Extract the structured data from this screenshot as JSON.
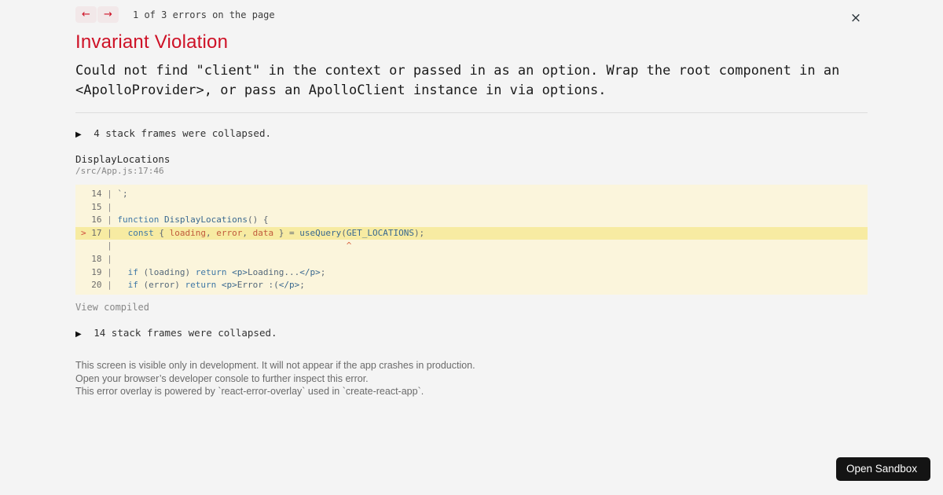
{
  "colors": {
    "accent_red": "#ce1126",
    "page_bg": "#f4f4f4",
    "code_bg": "#fbf5dc",
    "code_highlight_bg": "#f7eba2",
    "button_bg": "#141414"
  },
  "header": {
    "prev_label": "←",
    "next_label": "→",
    "counter": "1 of 3 errors on the page",
    "close_label": "×"
  },
  "error": {
    "title": "Invariant Violation",
    "message": "Could not find \"client\" in the context or passed in as an option. Wrap the root component in an <ApolloProvider>, or pass an ApolloClient instance in via options."
  },
  "stack": {
    "collapse_icon": "▶",
    "collapsed_top": "4 stack frames were collapsed.",
    "frame": {
      "function": "DisplayLocations",
      "location": "/src/App.js:17:46"
    },
    "view_compiled": "View compiled",
    "collapsed_bottom": "14 stack frames were collapsed."
  },
  "code": {
    "lines": [
      {
        "marker": "",
        "num": "14",
        "hl": false,
        "tokens": [
          {
            "t": "`;",
            "c": "pn"
          }
        ]
      },
      {
        "marker": "",
        "num": "15",
        "hl": false,
        "tokens": []
      },
      {
        "marker": "",
        "num": "16",
        "hl": false,
        "tokens": [
          {
            "t": "function",
            "c": "kw"
          },
          {
            "t": " ",
            "c": "pn"
          },
          {
            "t": "DisplayLocations",
            "c": "fn"
          },
          {
            "t": "() {",
            "c": "pn"
          }
        ]
      },
      {
        "marker": ">",
        "num": "17",
        "hl": true,
        "tokens": [
          {
            "t": "  ",
            "c": "pn"
          },
          {
            "t": "const",
            "c": "kw"
          },
          {
            "t": " { ",
            "c": "pn"
          },
          {
            "t": "loading",
            "c": "vr"
          },
          {
            "t": ", ",
            "c": "pn"
          },
          {
            "t": "error",
            "c": "vr"
          },
          {
            "t": ", ",
            "c": "pn"
          },
          {
            "t": "data",
            "c": "vr"
          },
          {
            "t": " } = ",
            "c": "pn"
          },
          {
            "t": "useQuery",
            "c": "fn"
          },
          {
            "t": "(",
            "c": "pn"
          },
          {
            "t": "GET_LOCATIONS",
            "c": "fn"
          },
          {
            "t": ");",
            "c": "pn"
          }
        ]
      },
      {
        "marker": "",
        "num": "",
        "hl": false,
        "tokens": [
          {
            "t": "                                            ^",
            "c": "caret"
          }
        ]
      },
      {
        "marker": "",
        "num": "18",
        "hl": false,
        "tokens": []
      },
      {
        "marker": "",
        "num": "19",
        "hl": false,
        "tokens": [
          {
            "t": "  ",
            "c": "pn"
          },
          {
            "t": "if",
            "c": "kw"
          },
          {
            "t": " (",
            "c": "pn"
          },
          {
            "t": "loading",
            "c": "id"
          },
          {
            "t": ") ",
            "c": "pn"
          },
          {
            "t": "return",
            "c": "kw"
          },
          {
            "t": " ",
            "c": "pn"
          },
          {
            "t": "<p>",
            "c": "tag"
          },
          {
            "t": "Loading...",
            "c": "id"
          },
          {
            "t": "</p>",
            "c": "tag"
          },
          {
            "t": ";",
            "c": "pn"
          }
        ]
      },
      {
        "marker": "",
        "num": "20",
        "hl": false,
        "tokens": [
          {
            "t": "  ",
            "c": "pn"
          },
          {
            "t": "if",
            "c": "kw"
          },
          {
            "t": " (",
            "c": "pn"
          },
          {
            "t": "error",
            "c": "id"
          },
          {
            "t": ") ",
            "c": "pn"
          },
          {
            "t": "return",
            "c": "kw"
          },
          {
            "t": " ",
            "c": "pn"
          },
          {
            "t": "<p>",
            "c": "tag"
          },
          {
            "t": "Error :(",
            "c": "id"
          },
          {
            "t": "</p>",
            "c": "tag"
          },
          {
            "t": ";",
            "c": "pn"
          }
        ]
      }
    ]
  },
  "footer": {
    "lines": [
      "This screen is visible only in development. It will not appear if the app crashes in production.",
      "Open your browser’s developer console to further inspect this error.",
      "This error overlay is powered by `react-error-overlay` used in `create-react-app`."
    ]
  },
  "sandbox_button": {
    "label": "Open Sandbox"
  }
}
